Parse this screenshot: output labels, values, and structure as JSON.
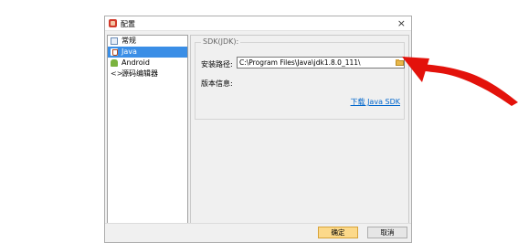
{
  "window": {
    "title": "配置",
    "close_glyph": "×"
  },
  "sidebar": {
    "items": [
      {
        "label": "常规",
        "icon": "settings-page-icon",
        "selected": false
      },
      {
        "label": "Java",
        "icon": "java-icon",
        "selected": true
      },
      {
        "label": "Android",
        "icon": "android-icon",
        "selected": false
      },
      {
        "label": "源码编辑器",
        "icon": "code-editor-icon",
        "code_glyph": "<>",
        "selected": false
      }
    ]
  },
  "sdk": {
    "group_title": "SDK(JDK):",
    "path_label": "安装路径:",
    "path_value": "C:\\Program Files\\Java\\jdk1.8.0_111\\",
    "version_label": "版本信息:",
    "download_link": "下载 Java SDK"
  },
  "buttons": {
    "ok": "确定",
    "cancel": "取消"
  },
  "annotation": {
    "arrow_color": "#e3120b"
  },
  "colors": {
    "selection": "#3a8ee6",
    "ok_button": "#fcd98a",
    "link": "#0066cc"
  }
}
